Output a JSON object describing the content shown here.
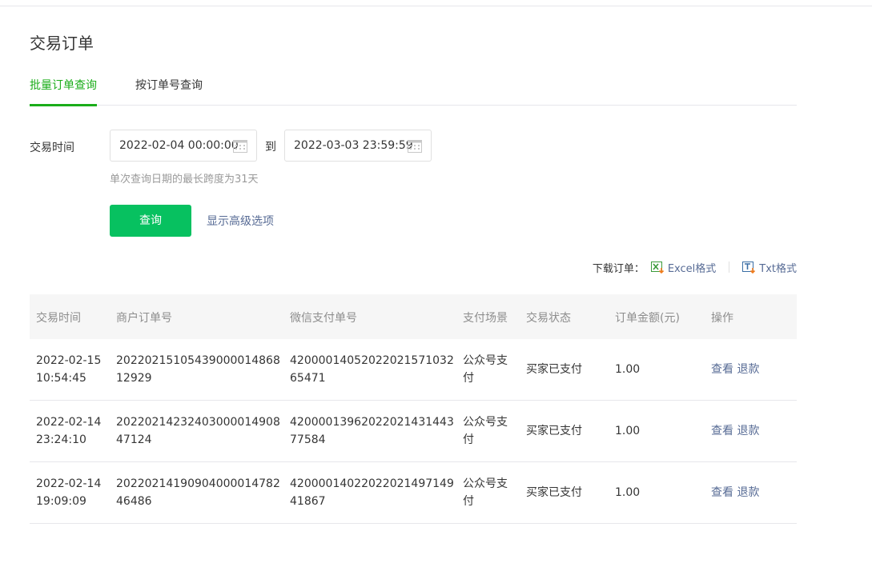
{
  "page": {
    "title": "交易订单"
  },
  "tabs": [
    {
      "label": "批量订单查询",
      "active": true
    },
    {
      "label": "按订单号查询",
      "active": false
    }
  ],
  "filter": {
    "time_label": "交易时间",
    "start_date": "2022-02-04 00:00:00",
    "to_text": "到",
    "end_date": "2022-03-03 23:59:59",
    "hint": "单次查询日期的最长跨度为31天",
    "query_button": "查询",
    "advanced_link": "显示高级选项"
  },
  "download": {
    "label": "下载订单：",
    "excel": "Excel格式",
    "txt": "Txt格式"
  },
  "table": {
    "headers": [
      "交易时间",
      "商户订单号",
      "微信支付单号",
      "支付场景",
      "交易状态",
      "订单金额(元)",
      "操作"
    ],
    "rows": [
      {
        "time": "2022-02-15 10:54:45",
        "merchant_order": "20220215105439000014868 12929",
        "wechat_order": "42000014052022021571032 65471",
        "scene": "公众号支付",
        "status": "买家已支付",
        "amount": "1.00",
        "view": "查看",
        "refund": "退款"
      },
      {
        "time": "2022-02-14 23:24:10",
        "merchant_order": "20220214232403000014908 47124",
        "wechat_order": "42000013962022021431443 77584",
        "scene": "公众号支付",
        "status": "买家已支付",
        "amount": "1.00",
        "view": "查看",
        "refund": "退款"
      },
      {
        "time": "2022-02-14 19:09:09",
        "merchant_order": "20220214190904000014782 46486",
        "wechat_order": "42000014022022021497149 41867",
        "scene": "公众号支付",
        "status": "买家已支付",
        "amount": "1.00",
        "view": "查看",
        "refund": "退款"
      }
    ]
  },
  "colors": {
    "accent_green": "#07c160",
    "tab_green": "#1aad19",
    "link_blue": "#576b95"
  }
}
